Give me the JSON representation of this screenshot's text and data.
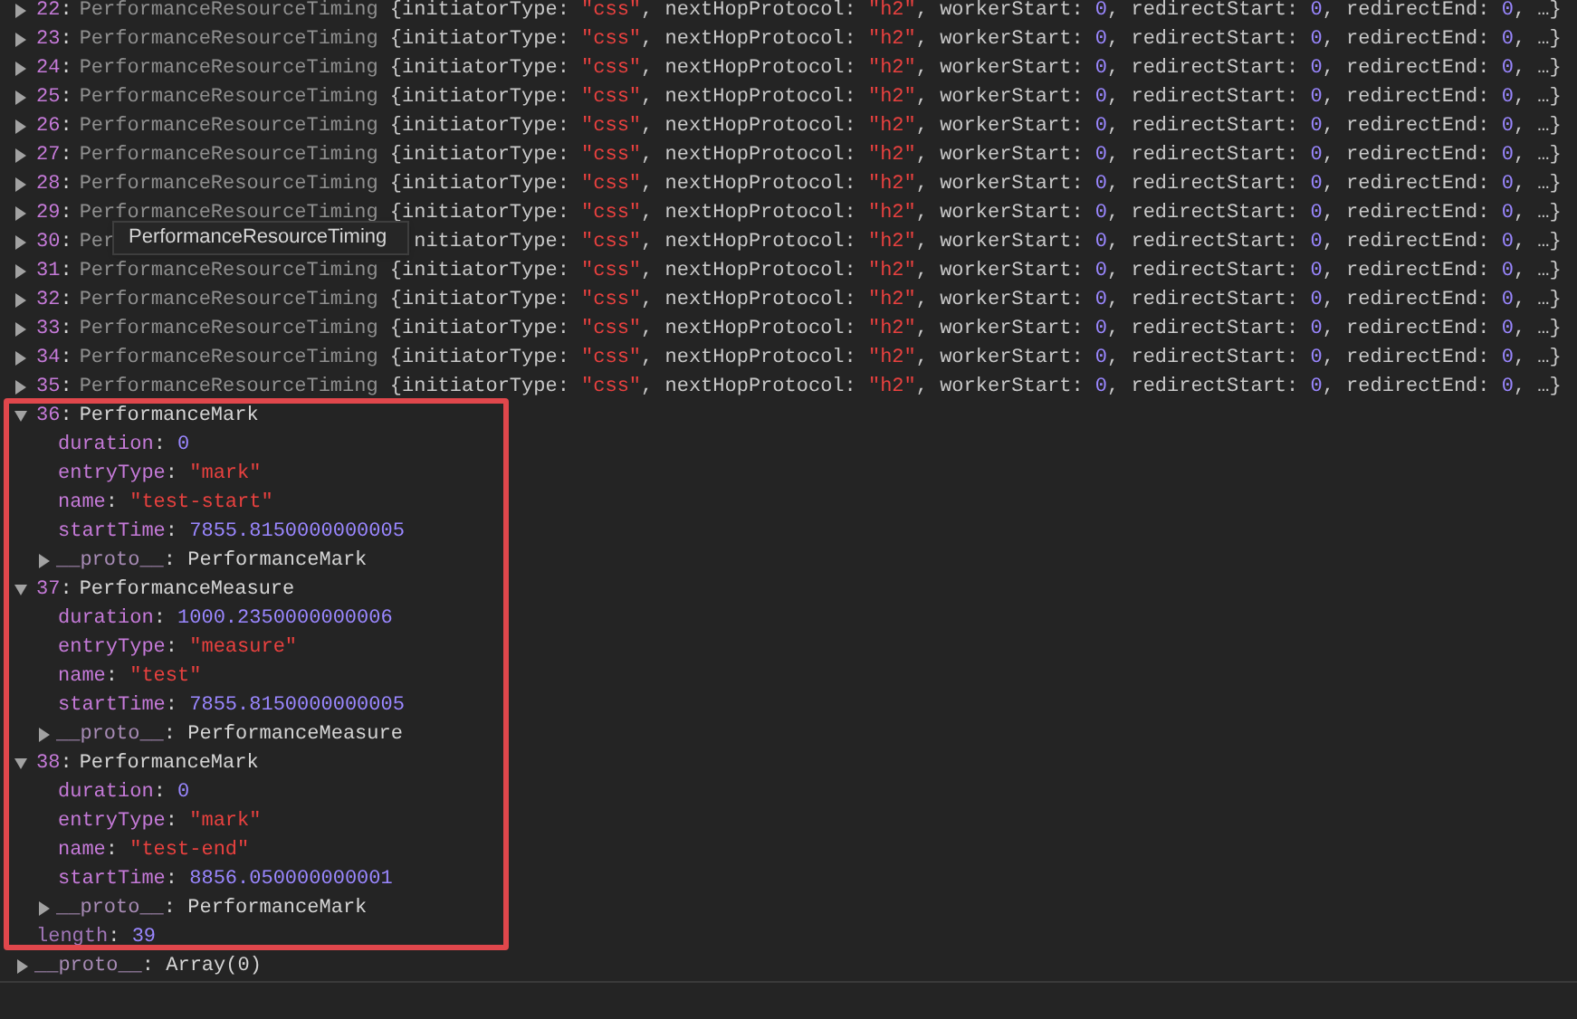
{
  "entries": [
    {
      "index": "22",
      "separator": ":",
      "class_name": "PerformanceResourceTiming",
      "expanded": false,
      "props": [
        {
          "key": "{initiatorType: ",
          "value": "\"css\"",
          "kind": "string"
        },
        {
          "key": ", nextHopProtocol: ",
          "value": "\"h2\"",
          "kind": "string"
        },
        {
          "key": ", workerStart: ",
          "value": "0",
          "kind": "number"
        },
        {
          "key": ", redirectStart: ",
          "value": "0",
          "kind": "number"
        },
        {
          "key": ", redirectEnd: ",
          "value": "0",
          "kind": "number"
        }
      ],
      "close": ", …}"
    },
    {
      "index": "23",
      "separator": ":",
      "class_name": "PerformanceResourceTiming",
      "expanded": false,
      "props": [
        {
          "key": "{initiatorType: ",
          "value": "\"css\"",
          "kind": "string"
        },
        {
          "key": ", nextHopProtocol: ",
          "value": "\"h2\"",
          "kind": "string"
        },
        {
          "key": ", workerStart: ",
          "value": "0",
          "kind": "number"
        },
        {
          "key": ", redirectStart: ",
          "value": "0",
          "kind": "number"
        },
        {
          "key": ", redirectEnd: ",
          "value": "0",
          "kind": "number"
        }
      ],
      "close": ", …}"
    },
    {
      "index": "24",
      "separator": ":",
      "class_name": "PerformanceResourceTiming",
      "expanded": false,
      "props": [
        {
          "key": "{initiatorType: ",
          "value": "\"css\"",
          "kind": "string"
        },
        {
          "key": ", nextHopProtocol: ",
          "value": "\"h2\"",
          "kind": "string"
        },
        {
          "key": ", workerStart: ",
          "value": "0",
          "kind": "number"
        },
        {
          "key": ", redirectStart: ",
          "value": "0",
          "kind": "number"
        },
        {
          "key": ", redirectEnd: ",
          "value": "0",
          "kind": "number"
        }
      ],
      "close": ", …}"
    },
    {
      "index": "25",
      "separator": ":",
      "class_name": "PerformanceResourceTiming",
      "expanded": false,
      "props": [
        {
          "key": "{initiatorType: ",
          "value": "\"css\"",
          "kind": "string"
        },
        {
          "key": ", nextHopProtocol: ",
          "value": "\"h2\"",
          "kind": "string"
        },
        {
          "key": ", workerStart: ",
          "value": "0",
          "kind": "number"
        },
        {
          "key": ", redirectStart: ",
          "value": "0",
          "kind": "number"
        },
        {
          "key": ", redirectEnd: ",
          "value": "0",
          "kind": "number"
        }
      ],
      "close": ", …}"
    },
    {
      "index": "26",
      "separator": ":",
      "class_name": "PerformanceResourceTiming",
      "expanded": false,
      "props": [
        {
          "key": "{initiatorType: ",
          "value": "\"css\"",
          "kind": "string"
        },
        {
          "key": ", nextHopProtocol: ",
          "value": "\"h2\"",
          "kind": "string"
        },
        {
          "key": ", workerStart: ",
          "value": "0",
          "kind": "number"
        },
        {
          "key": ", redirectStart: ",
          "value": "0",
          "kind": "number"
        },
        {
          "key": ", redirectEnd: ",
          "value": "0",
          "kind": "number"
        }
      ],
      "close": ", …}"
    },
    {
      "index": "27",
      "separator": ":",
      "class_name": "PerformanceResourceTiming",
      "expanded": false,
      "props": [
        {
          "key": "{initiatorType: ",
          "value": "\"css\"",
          "kind": "string"
        },
        {
          "key": ", nextHopProtocol: ",
          "value": "\"h2\"",
          "kind": "string"
        },
        {
          "key": ", workerStart: ",
          "value": "0",
          "kind": "number"
        },
        {
          "key": ", redirectStart: ",
          "value": "0",
          "kind": "number"
        },
        {
          "key": ", redirectEnd: ",
          "value": "0",
          "kind": "number"
        }
      ],
      "close": ", …}"
    },
    {
      "index": "28",
      "separator": ":",
      "class_name": "PerformanceResourceTiming",
      "expanded": false,
      "props": [
        {
          "key": "{initiatorType: ",
          "value": "\"css\"",
          "kind": "string"
        },
        {
          "key": ", nextHopProtocol: ",
          "value": "\"h2\"",
          "kind": "string"
        },
        {
          "key": ", workerStart: ",
          "value": "0",
          "kind": "number"
        },
        {
          "key": ", redirectStart: ",
          "value": "0",
          "kind": "number"
        },
        {
          "key": ", redirectEnd: ",
          "value": "0",
          "kind": "number"
        }
      ],
      "close": ", …}"
    },
    {
      "index": "29",
      "separator": ":",
      "class_name": "PerformanceResourceTiming",
      "expanded": false,
      "props": [
        {
          "key": "{initiatorType: ",
          "value": "\"css\"",
          "kind": "string"
        },
        {
          "key": ", nextHopProtocol: ",
          "value": "\"h2\"",
          "kind": "string"
        },
        {
          "key": ", workerStart: ",
          "value": "0",
          "kind": "number"
        },
        {
          "key": ", redirectStart: ",
          "value": "0",
          "kind": "number"
        },
        {
          "key": ", redirectEnd: ",
          "value": "0",
          "kind": "number"
        }
      ],
      "close": ", …}"
    },
    {
      "index": "30",
      "separator": ":",
      "class_name": "Per",
      "expanded": false,
      "props": [
        {
          "key": "nitiatorType: ",
          "value": "\"css\"",
          "kind": "string"
        },
        {
          "key": ", nextHopProtocol: ",
          "value": "\"h2\"",
          "kind": "string"
        },
        {
          "key": ", workerStart: ",
          "value": "0",
          "kind": "number"
        },
        {
          "key": ", redirectStart: ",
          "value": "0",
          "kind": "number"
        },
        {
          "key": ", redirectEnd: ",
          "value": "0",
          "kind": "number"
        }
      ],
      "close": ", …}"
    },
    {
      "index": "31",
      "separator": ":",
      "class_name": "PerformanceResourceTiming",
      "expanded": false,
      "props": [
        {
          "key": "{initiatorType: ",
          "value": "\"css\"",
          "kind": "string"
        },
        {
          "key": ", nextHopProtocol: ",
          "value": "\"h2\"",
          "kind": "string"
        },
        {
          "key": ", workerStart: ",
          "value": "0",
          "kind": "number"
        },
        {
          "key": ", redirectStart: ",
          "value": "0",
          "kind": "number"
        },
        {
          "key": ", redirectEnd: ",
          "value": "0",
          "kind": "number"
        }
      ],
      "close": ", …}"
    },
    {
      "index": "32",
      "separator": ":",
      "class_name": "PerformanceResourceTiming",
      "expanded": false,
      "props": [
        {
          "key": "{initiatorType: ",
          "value": "\"css\"",
          "kind": "string"
        },
        {
          "key": ", nextHopProtocol: ",
          "value": "\"h2\"",
          "kind": "string"
        },
        {
          "key": ", workerStart: ",
          "value": "0",
          "kind": "number"
        },
        {
          "key": ", redirectStart: ",
          "value": "0",
          "kind": "number"
        },
        {
          "key": ", redirectEnd: ",
          "value": "0",
          "kind": "number"
        }
      ],
      "close": ", …}"
    },
    {
      "index": "33",
      "separator": ":",
      "class_name": "PerformanceResourceTiming",
      "expanded": false,
      "props": [
        {
          "key": "{initiatorType: ",
          "value": "\"css\"",
          "kind": "string"
        },
        {
          "key": ", nextHopProtocol: ",
          "value": "\"h2\"",
          "kind": "string"
        },
        {
          "key": ", workerStart: ",
          "value": "0",
          "kind": "number"
        },
        {
          "key": ", redirectStart: ",
          "value": "0",
          "kind": "number"
        },
        {
          "key": ", redirectEnd: ",
          "value": "0",
          "kind": "number"
        }
      ],
      "close": ", …}"
    },
    {
      "index": "34",
      "separator": ":",
      "class_name": "PerformanceResourceTiming",
      "expanded": false,
      "props": [
        {
          "key": "{initiatorType: ",
          "value": "\"css\"",
          "kind": "string"
        },
        {
          "key": ", nextHopProtocol: ",
          "value": "\"h2\"",
          "kind": "string"
        },
        {
          "key": ", workerStart: ",
          "value": "0",
          "kind": "number"
        },
        {
          "key": ", redirectStart: ",
          "value": "0",
          "kind": "number"
        },
        {
          "key": ", redirectEnd: ",
          "value": "0",
          "kind": "number"
        }
      ],
      "close": ", …}"
    },
    {
      "index": "35",
      "separator": ":",
      "class_name": "PerformanceResourceTiming",
      "expanded": false,
      "props": [
        {
          "key": "{initiatorType: ",
          "value": "\"css\"",
          "kind": "string"
        },
        {
          "key": ", nextHopProtocol: ",
          "value": "\"h2\"",
          "kind": "string"
        },
        {
          "key": ", workerStart: ",
          "value": "0",
          "kind": "number"
        },
        {
          "key": ", redirectStart: ",
          "value": "0",
          "kind": "number"
        },
        {
          "key": ", redirectEnd: ",
          "value": "0",
          "kind": "number"
        }
      ],
      "close": ", …}"
    },
    {
      "index": "36",
      "separator": ":",
      "class_name": "PerformanceMark",
      "expanded": true,
      "props": [
        {
          "key": "duration",
          "separator": ": ",
          "value": "0",
          "kind": "number"
        },
        {
          "key": "entryType",
          "separator": ": ",
          "value": "\"mark\"",
          "kind": "string"
        },
        {
          "key": "name",
          "separator": ": ",
          "value": "\"test-start\"",
          "kind": "string"
        },
        {
          "key": "startTime",
          "separator": ": ",
          "value": "7855.8150000000005",
          "kind": "number"
        },
        {
          "key": "__proto__",
          "separator": ": ",
          "value": "PerformanceMark",
          "kind": "object"
        }
      ]
    },
    {
      "index": "37",
      "separator": ":",
      "class_name": "PerformanceMeasure",
      "expanded": true,
      "props": [
        {
          "key": "duration",
          "separator": ": ",
          "value": "1000.2350000000006",
          "kind": "number"
        },
        {
          "key": "entryType",
          "separator": ": ",
          "value": "\"measure\"",
          "kind": "string"
        },
        {
          "key": "name",
          "separator": ": ",
          "value": "\"test\"",
          "kind": "string"
        },
        {
          "key": "startTime",
          "separator": ": ",
          "value": "7855.8150000000005",
          "kind": "number"
        },
        {
          "key": "__proto__",
          "separator": ": ",
          "value": "PerformanceMeasure",
          "kind": "object"
        }
      ]
    },
    {
      "index": "38",
      "separator": ":",
      "class_name": "PerformanceMark",
      "expanded": true,
      "props": [
        {
          "key": "duration",
          "separator": ": ",
          "value": "0",
          "kind": "number"
        },
        {
          "key": "entryType",
          "separator": ": ",
          "value": "\"mark\"",
          "kind": "string"
        },
        {
          "key": "name",
          "separator": ": ",
          "value": "\"test-end\"",
          "kind": "string"
        },
        {
          "key": "startTime",
          "separator": ": ",
          "value": "8856.050000000001",
          "kind": "number"
        },
        {
          "key": "__proto__",
          "separator": ": ",
          "value": "PerformanceMark",
          "kind": "object"
        }
      ]
    }
  ],
  "array_props": [
    {
      "key": "length",
      "separator": ": ",
      "value": "39",
      "kind": "number"
    },
    {
      "key": "__proto__",
      "separator": ": ",
      "value": "Array(0)",
      "kind": "object"
    }
  ],
  "tooltip": {
    "text": "PerformanceResourceTiming"
  }
}
